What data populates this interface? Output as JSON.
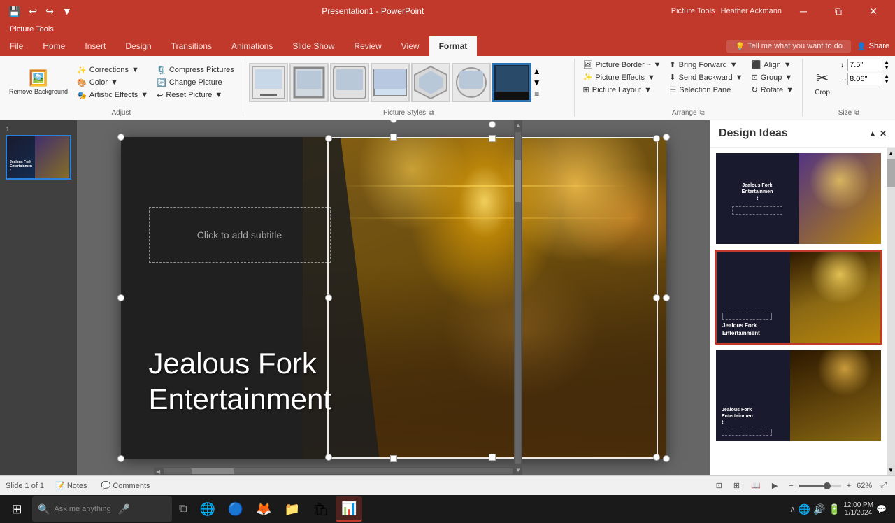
{
  "titlebar": {
    "title": "Presentation1 - PowerPoint",
    "picture_tools": "Picture Tools",
    "user": "Heather Ackmann"
  },
  "quickaccess": {
    "save": "💾",
    "undo": "↩",
    "redo": "↪",
    "customize": "▼"
  },
  "ribbon": {
    "tabs": [
      "File",
      "Home",
      "Insert",
      "Design",
      "Transitions",
      "Animations",
      "Slide Show",
      "Review",
      "View"
    ],
    "format_tab": "Format",
    "tell_me": "Tell me what you want to do",
    "share": "Share",
    "groups": {
      "adjust": {
        "label": "Adjust",
        "remove_bg": "Remove Background",
        "corrections": "Corrections",
        "color": "Color",
        "artistic": "Artistic Effects",
        "compress": "Compress Pictures",
        "change": "Change Picture",
        "reset": "Reset Picture"
      },
      "picture_styles": {
        "label": "Picture Styles"
      },
      "arrange": {
        "label": "Arrange",
        "picture_border": "Picture Border",
        "picture_effects": "Picture Effects",
        "picture_layout": "Picture Layout",
        "bring_forward": "Bring Forward",
        "send_backward": "Send Backward",
        "selection_pane": "Selection Pane",
        "align": "Align",
        "group": "Group",
        "rotate": "Rotate"
      },
      "size": {
        "label": "Size",
        "crop": "Crop",
        "height_label": "Height",
        "width_label": "Width",
        "height_value": "7.5\"",
        "width_value": "8.06\""
      }
    }
  },
  "slide": {
    "number": "1",
    "title": "Jealous Fork\nEntertainment",
    "subtitle_placeholder": "Click to add subtitle"
  },
  "status_bar": {
    "slide_info": "Slide 1 of 1",
    "notes": "Notes",
    "comments": "Comments",
    "zoom": "62%"
  },
  "design_panel": {
    "title": "Design Ideas",
    "close_btn": "✕",
    "collapse_btn": "▲"
  },
  "taskbar": {
    "start": "⊞",
    "search_placeholder": "Ask me anything",
    "time": "12:00 PM",
    "date": "1/1/2024"
  }
}
